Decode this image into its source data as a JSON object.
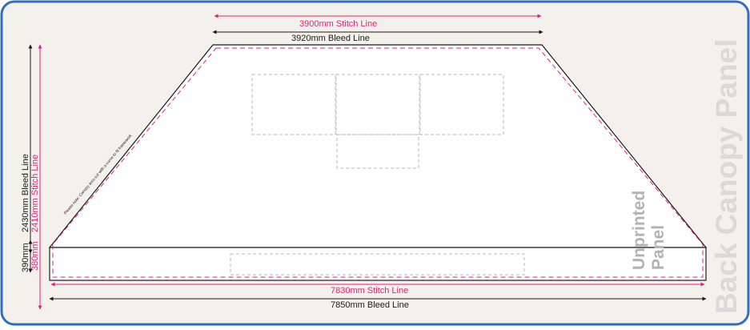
{
  "colors": {
    "frame_border": "#2e6fc4",
    "frame_fill": "#f4f1ec",
    "panel_fill": "#ffffff",
    "bleed_line": "#1a1a1a",
    "stitch_line": "#e0227a",
    "placeholder": "#b8b8b8",
    "side_title": "#d9d9d9",
    "unprinted_text": "#b3b3b3"
  },
  "dimensions": {
    "top_stitch": "3900mm Stitch Line",
    "top_bleed": "3920mm Bleed Line",
    "bottom_stitch": "7830mm Stitch Line",
    "bottom_bleed": "7850mm Bleed Line",
    "height_bleed": "2430mm Bleed Line",
    "height_stitch": "2410mm Stitch Line",
    "strip_bleed": "390mm",
    "strip_stitch": "380mm"
  },
  "notes": {
    "curve_note": "Please note: Canopy arcs cut with a curve to fit framework"
  },
  "labels": {
    "unprinted_line1": "Unprinted",
    "unprinted_line2": "Panel",
    "side_title": "Back Canopy Panel"
  }
}
